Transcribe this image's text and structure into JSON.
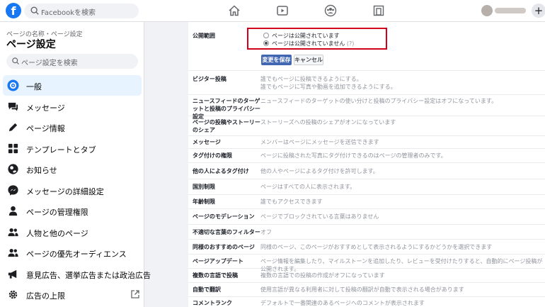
{
  "topbar": {
    "logo": "f",
    "search_placeholder": "Facebookを検索",
    "nav_icons": [
      "home-icon",
      "watch-icon",
      "groups-icon",
      "gaming-icon"
    ],
    "create_label": "+"
  },
  "sidebar": {
    "breadcrumb": "ページの名称・ページ設定",
    "title": "ページ設定",
    "search_placeholder": "ページ設定を検索",
    "items": [
      {
        "label": "一般",
        "icon": "gear-icon",
        "active": true
      },
      {
        "label": "メッセージ",
        "icon": "chat-bubble-icon"
      },
      {
        "label": "ページ情報",
        "icon": "pencil-icon"
      },
      {
        "label": "テンプレートとタブ",
        "icon": "grid-icon"
      },
      {
        "label": "お知らせ",
        "icon": "globe-icon"
      },
      {
        "label": "メッセージの詳細設定",
        "icon": "messenger-icon"
      },
      {
        "label": "ページの管理権限",
        "icon": "person-icon"
      },
      {
        "label": "人物と他のページ",
        "icon": "people-icon"
      },
      {
        "label": "ページの優先オーディエンス",
        "icon": "people-icon"
      },
      {
        "label": "意見広告、選挙広告または政治広告",
        "icon": "megaphone-icon"
      },
      {
        "label": "広告の上限",
        "icon": "gear-icon"
      }
    ]
  },
  "settings": {
    "visibility": {
      "label": "公開範囲",
      "option_published": "ページは公開されています",
      "option_unpublished": "ページは公開されていません",
      "help": "(?)",
      "save": "変更を保存",
      "cancel": "キャンセル"
    },
    "rows": [
      {
        "label": "ビジター投稿",
        "value": "誰でもページに投稿できるようにする。\n誰でもページに写真や動画を追加できるようにする。"
      },
      {
        "label": "ニュースフィードのターゲットと投稿のプライバシー設定",
        "value": "ニュースフィードのターゲットの使い分けと投稿のプライバシー設定はオフになっています。"
      },
      {
        "label": "ページの投稿やストーリーのシェア",
        "value": "ストーリーズへの投稿のシェアがオンになっています"
      },
      {
        "label": "メッセージ",
        "value": "メンバーはページにメッセージを送信できます"
      },
      {
        "label": "タグ付けの権限",
        "value": "ページに投稿された写真にタグ付けできるのはページの管理者のみです。"
      },
      {
        "label": "他の人によるタグ付け",
        "value": "他の人やページによるタグ付けを許可します。"
      },
      {
        "label": "国別制限",
        "value": "ページはすべての人に表示されます。"
      },
      {
        "label": "年齢制限",
        "value": "誰でもアクセスできます"
      },
      {
        "label": "ページのモデレーション",
        "value": "ページでブロックされている言葉はありません"
      },
      {
        "label": "不適切な言葉のフィルター",
        "value": "オフ"
      },
      {
        "label": "同様のおすすめのページ",
        "value": "同様のページ、このページがおすすめとして表示されるようにするかどうかを選択できます"
      },
      {
        "label": "ページアップデート",
        "value": "ページ情報を編集したり、マイルストーンを追加したり、レビューを受付けたりすると、自動的にページ投稿が公開されます。"
      },
      {
        "label": "複数の言語で投稿",
        "value": "複数の言語での投稿の作成がオフになっています"
      },
      {
        "label": "自動で翻訳",
        "value": "使用言語が異なる利用者に対して投稿の翻訳が自動で表示される場合があります"
      },
      {
        "label": "コメントランク",
        "value": "デフォルトで一番関連のあるページへのコメントが表示されます"
      }
    ]
  }
}
